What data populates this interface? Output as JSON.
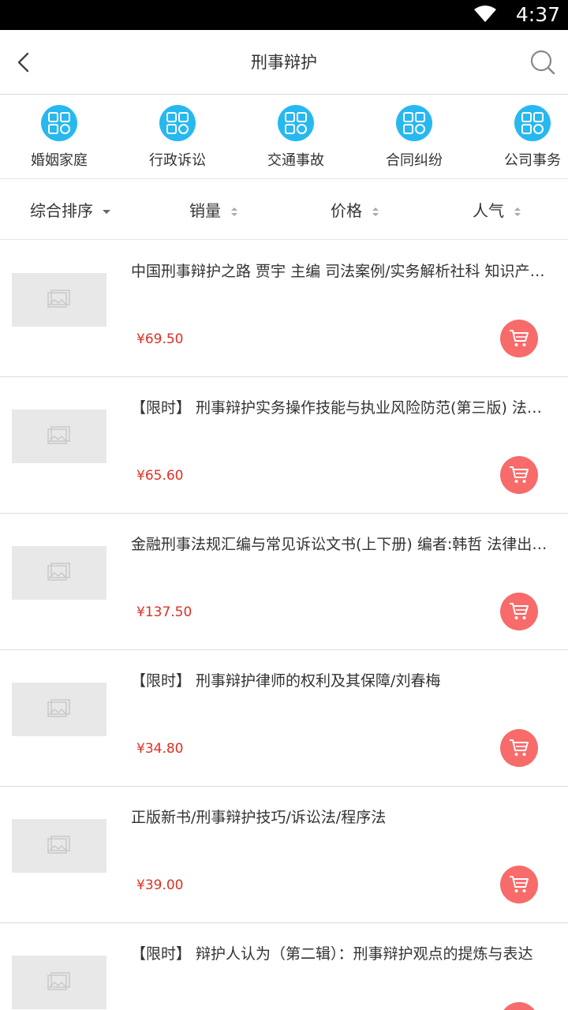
{
  "status_bar": {
    "time": "4:37",
    "icons": [
      "wifi-icon"
    ]
  },
  "nav": {
    "title": "刑事辩护",
    "back_icon": "chevron-left-icon",
    "search_icon": "search-icon"
  },
  "categories": [
    {
      "label": "婚姻家庭",
      "icon": "apps-grid-icon"
    },
    {
      "label": "行政诉讼",
      "icon": "apps-grid-icon"
    },
    {
      "label": "交通事故",
      "icon": "apps-grid-icon"
    },
    {
      "label": "合同纠纷",
      "icon": "apps-grid-icon"
    },
    {
      "label": "公司事务",
      "icon": "apps-grid-icon"
    }
  ],
  "sorts": [
    {
      "label": "综合排序",
      "indicator": "caret-down"
    },
    {
      "label": "销量",
      "indicator": "caret-up-down"
    },
    {
      "label": "价格",
      "indicator": "caret-up-down"
    },
    {
      "label": "人气",
      "indicator": "caret-up-down"
    }
  ],
  "products": [
    {
      "name": "中国刑事辩护之路 贾宇 主编 司法案例/实务解析社科 知识产权出版社",
      "price": "¥69.50"
    },
    {
      "name": "【限时】 刑事辩护实务操作技能与执业风险防范(第三版) 法律出版社",
      "price": "¥65.60"
    },
    {
      "name": "金融刑事法规汇编与常见诉讼文书(上下册) 编者:韩哲 法律出版社",
      "price": "¥137.50"
    },
    {
      "name": "【限时】 刑事辩护律师的权利及其保障/刘春梅",
      "price": "¥34.80"
    },
    {
      "name": "正版新书/刑事辩护技巧/诉讼法/程序法",
      "price": "¥39.00"
    },
    {
      "name": "【限时】 辩护人认为（第二辑）：刑事辩护观点的提炼与表达",
      "price": ""
    }
  ],
  "colors": {
    "accent": "#27b8ef",
    "price": "#e02e24",
    "cart": "#f76b6b",
    "placeholder": "#e8e8e8"
  }
}
